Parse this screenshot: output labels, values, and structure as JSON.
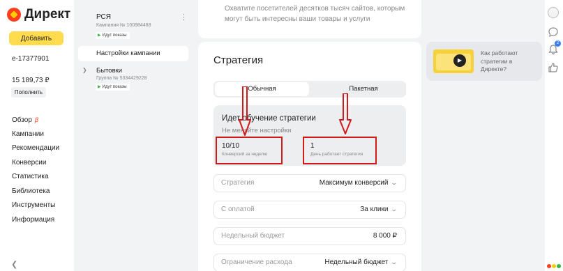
{
  "app": {
    "logo_text": "Директ",
    "add_button": "Добавить"
  },
  "account": {
    "login": "e-17377901",
    "balance": "15 189,73 ₽",
    "topup_button": "Пополнить"
  },
  "nav": {
    "items": [
      "Обзор",
      "Кампании",
      "Рекомендации",
      "Конверсии",
      "Статистика",
      "Библиотека",
      "Инструменты",
      "Информация"
    ],
    "beta_mark": "β"
  },
  "campaign": {
    "name": "РСЯ",
    "number": "Кампания № 100984468",
    "status": "Идут показы",
    "settings_item": "Настройки кампании",
    "group": {
      "name": "Бытовки",
      "number": "Группа № 5334429228",
      "status": "Идут показы"
    }
  },
  "intro": {
    "text": "Охватите посетителей десятков тысяч сайтов, которым могут быть интересны ваши товары и услуги"
  },
  "strategy": {
    "title": "Стратегия",
    "tabs": [
      "Обычная",
      "Пакетная"
    ],
    "selected_tab": "Обычная",
    "learning": {
      "title": "Идет обучение стратегии",
      "subtitle": "Не меняйте настройки",
      "conversions_value": "10/10",
      "conversions_label": "Конверсий за неделю",
      "days_value": "1",
      "days_label": "День работает стратегия"
    },
    "fields": [
      {
        "label": "Стратегия",
        "value": "Максимум конверсий",
        "dropdown": true
      },
      {
        "label": "С оплатой",
        "value": "За клики",
        "dropdown": true
      },
      {
        "label": "Недельный бюджет",
        "value": "8 000 ₽",
        "dropdown": false
      },
      {
        "label": "Ограничение расхода",
        "value": "Недельный бюджет",
        "dropdown": true
      }
    ]
  },
  "promo": {
    "text": "Как работают стратегии в Директе?"
  },
  "rail": {
    "notifications_count": "2"
  },
  "colors": {
    "accent_yellow": "#ffdb4d",
    "annotation_red": "#d11a1a",
    "brand_red": "#fc3f1d"
  }
}
